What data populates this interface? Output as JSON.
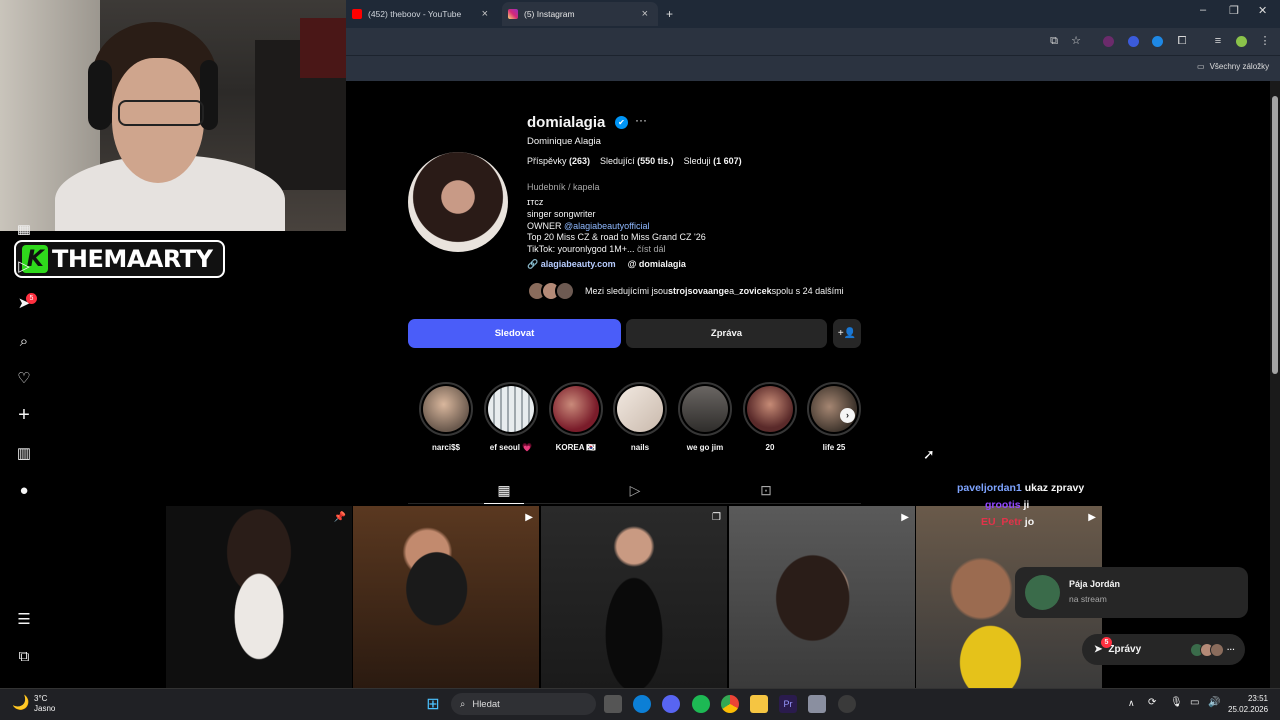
{
  "browser": {
    "tabs": [
      {
        "label": "(452) theboov - YouTube",
        "active": false,
        "favicon_color": "#ff0000"
      },
      {
        "label": "(5) Instagram",
        "active": true,
        "favicon_color": "#d62976"
      }
    ],
    "bookmarks_label": "Všechny záložky"
  },
  "overlay": {
    "logo_letter": "K",
    "logo_text": "THEMAARTY"
  },
  "nav": {
    "notifications_badge": "5"
  },
  "profile": {
    "username": "domialagia",
    "verified_icon": "✔",
    "full_name": "Dominique Alagia",
    "stats": {
      "posts_label": "Příspěvky",
      "posts": "(263)",
      "followers_label": "Sledující",
      "followers": "(550 tis.)",
      "following_label": "Sleduji",
      "following": "(1 607)"
    },
    "category": "Hudebník / kapela",
    "bio": {
      "line1": "ɪᴛᴄᴢ",
      "line2": "singer songwriter",
      "line3_prefix": "OWNER ",
      "line3_mention": "@alagiabeautyofficial",
      "line4": "Top 20 Miss CZ & road to Miss Grand CZ '26",
      "line5": "TikTok: youronlygod 1M+...",
      "read_more": "číst dál"
    },
    "link_web": "alagiabeauty.com",
    "link_threads": "domialagia",
    "mutuals": {
      "prefix": "Mezi sledujícími jsou ",
      "user1": "strojsovaange",
      "mid": " a ",
      "user2": "_zovicek",
      "suffix": " spolu s 24 dalšími"
    },
    "follow_button": "Sledovat",
    "message_button": "Zpráva"
  },
  "highlights": [
    {
      "label": "narci$$",
      "color": "#6b5a4e"
    },
    {
      "label": "ef seoul 💗",
      "color": "#cfd3d6"
    },
    {
      "label": "KOREA 🇰🇷",
      "color": "#7a1c2a"
    },
    {
      "label": "nails",
      "color": "#e8dcd3"
    },
    {
      "label": "we go jim",
      "color": "#4c4a48"
    },
    {
      "label": "20",
      "color": "#5a2a2a"
    },
    {
      "label": "life 25",
      "color": "#6b5646"
    }
  ],
  "posts": [
    {
      "kind": "pinned",
      "bg": "#111111",
      "accent": "#f0f0f0"
    },
    {
      "kind": "reel",
      "bg": "#3a2416",
      "accent": "#1a1a1a"
    },
    {
      "kind": "carousel",
      "bg": "#222222",
      "accent": "#0d0d0d"
    },
    {
      "kind": "reel",
      "bg": "#4a4a4a",
      "accent": "#2a1d18"
    },
    {
      "kind": "reel",
      "bg": "#5a4a3a",
      "accent": "#e5c21a"
    }
  ],
  "chat": [
    {
      "user": "paveljordan1",
      "msg": "ukaz zpravy",
      "class": "u1"
    },
    {
      "user": "grootis",
      "msg": "ji",
      "class": "u2"
    },
    {
      "user": "EU_Petr",
      "msg": "jo",
      "class": "u3"
    }
  ],
  "toast": {
    "name": "Pája Jordán",
    "sub": "na stream"
  },
  "messages": {
    "label": "Zprávy",
    "badge": "5"
  },
  "taskbar": {
    "weather_temp": "3°C",
    "weather_desc": "Jasno",
    "search_placeholder": "Hledat",
    "time": "23:51",
    "date": "25.02.2026"
  }
}
